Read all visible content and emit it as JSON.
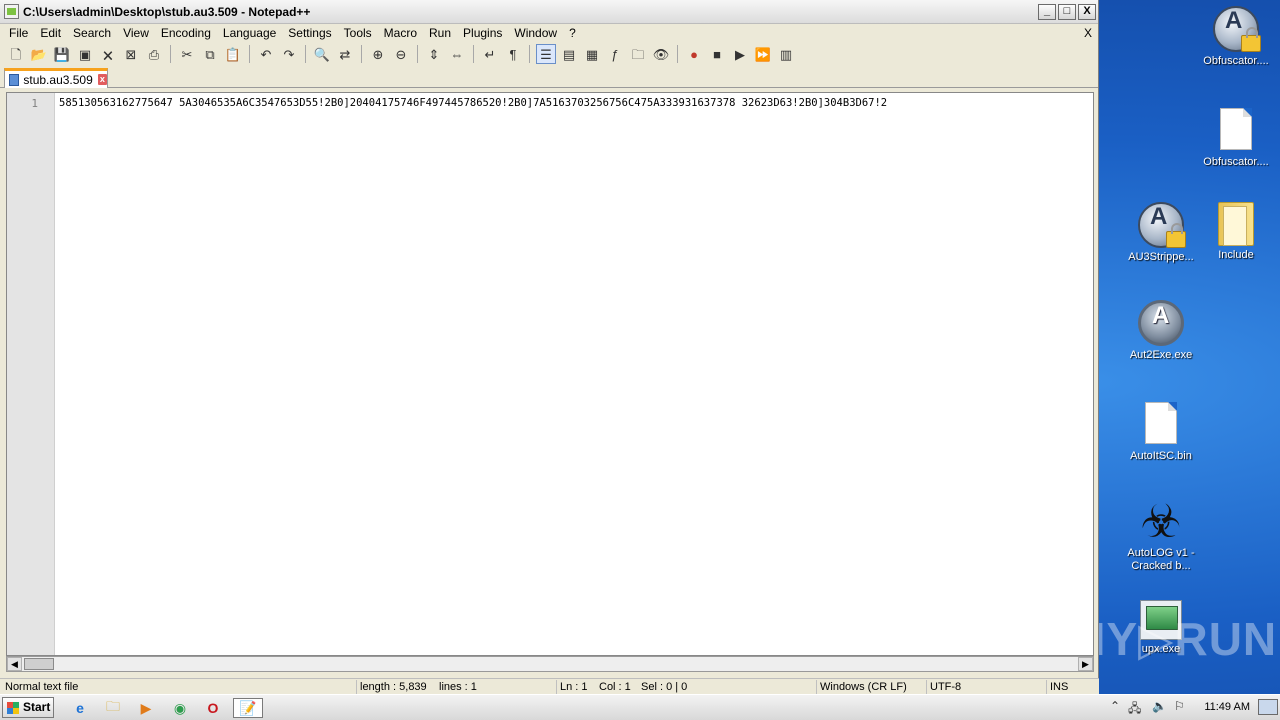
{
  "window": {
    "title": "C:\\Users\\admin\\Desktop\\stub.au3.509 - Notepad++",
    "btn_min": "_",
    "btn_max": "□",
    "btn_close": "X"
  },
  "menu": {
    "items": [
      "File",
      "Edit",
      "Search",
      "View",
      "Encoding",
      "Language",
      "Settings",
      "Tools",
      "Macro",
      "Run",
      "Plugins",
      "Window",
      "?"
    ],
    "close_doc": "X"
  },
  "toolbar": {
    "icons": [
      "new-file",
      "open-file",
      "save",
      "save-all",
      "close",
      "close-all",
      "print",
      "cut",
      "copy",
      "paste",
      "undo",
      "redo",
      "find",
      "replace",
      "zoom-in",
      "zoom-out",
      "sync-vertical",
      "sync-horizontal",
      "word-wrap",
      "show-all-chars",
      "indent-guide",
      "user-defined-language",
      "doc-map",
      "function-list",
      "folder-as-workspace",
      "monitoring",
      "record-macro",
      "stop-recording",
      "playback",
      "run-macro-multiple",
      "save-macro"
    ]
  },
  "tab": {
    "label": "stub.au3.509",
    "close_glyph": "x"
  },
  "editor": {
    "line_number": "1",
    "line_text": "585130563162775647 5A3046535A6C3547653D55!2B0]20404175746F497445786520!2B0]7A5163703256756C475A333931637378 32623D63!2B0]304B3D67!2"
  },
  "status": {
    "file_type": "Normal text file",
    "length": "length : 5,839",
    "lines": "lines : 1",
    "ln": "Ln : 1",
    "col": "Col : 1",
    "sel": "Sel : 0 | 0",
    "eol": "Windows (CR LF)",
    "encoding": "UTF-8",
    "mode": "INS"
  },
  "desktop": {
    "icons": [
      {
        "label": "Obfuscator....",
        "icon": "autoit-lock-icon"
      },
      {
        "label": "Obfuscator....",
        "icon": "document-icon"
      },
      {
        "label": "AU3Strippe...",
        "icon": "autoit-lock-icon"
      },
      {
        "label": "Include",
        "icon": "folder-icon"
      },
      {
        "label": "Aut2Exe.exe",
        "icon": "aut2exe-icon"
      },
      {
        "label": "AutoItSC.bin",
        "icon": "document-icon"
      },
      {
        "label": "AutoLOG v1 - Cracked b...",
        "icon": "biohazard-icon"
      },
      {
        "label": "upx.exe",
        "icon": "upx-icon"
      }
    ],
    "watermark": "ANY▷RUN"
  },
  "taskbar": {
    "start_label": "Start",
    "clock": "11:49 AM",
    "apps": [
      "ie-icon",
      "explorer-icon",
      "media-player-icon",
      "chrome-icon",
      "opera-icon",
      "notepad-plus-plus-icon"
    ]
  }
}
